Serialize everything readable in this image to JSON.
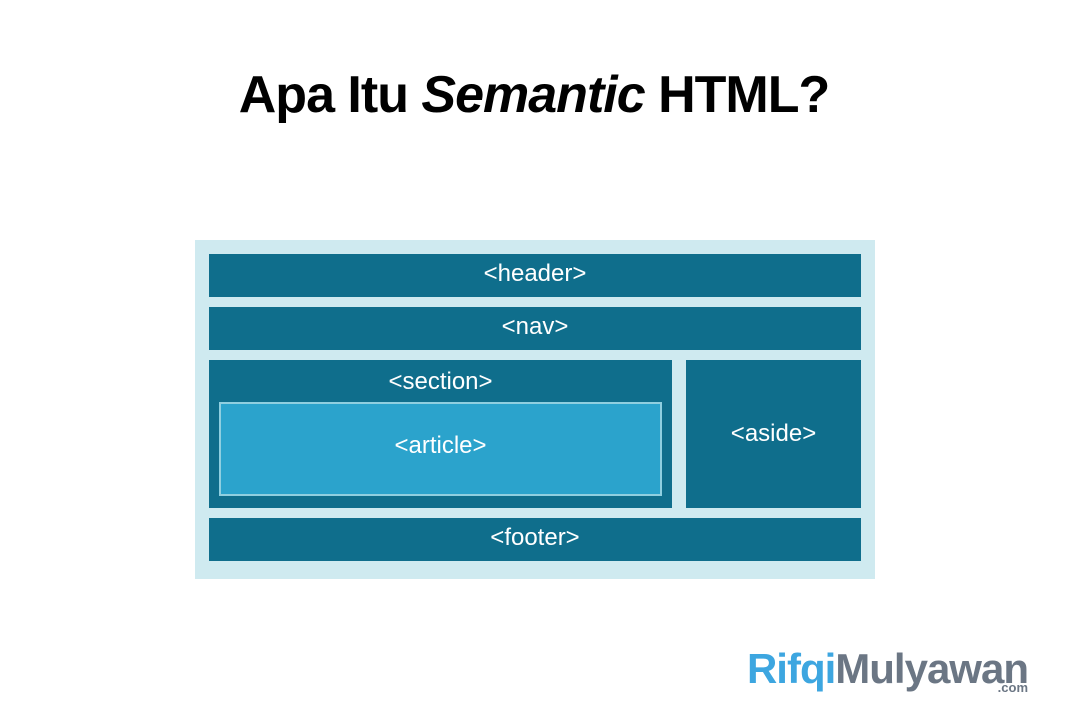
{
  "title": {
    "pre": "Apa Itu ",
    "italic": "Semantic",
    "post": " HTML?"
  },
  "diagram": {
    "header": "<header>",
    "nav": "<nav>",
    "section": "<section>",
    "article": "<article>",
    "aside": "<aside>",
    "footer": "<footer>"
  },
  "watermark": {
    "first": "Rifqi",
    "last": "Mulyawan",
    "tld": ".com"
  }
}
